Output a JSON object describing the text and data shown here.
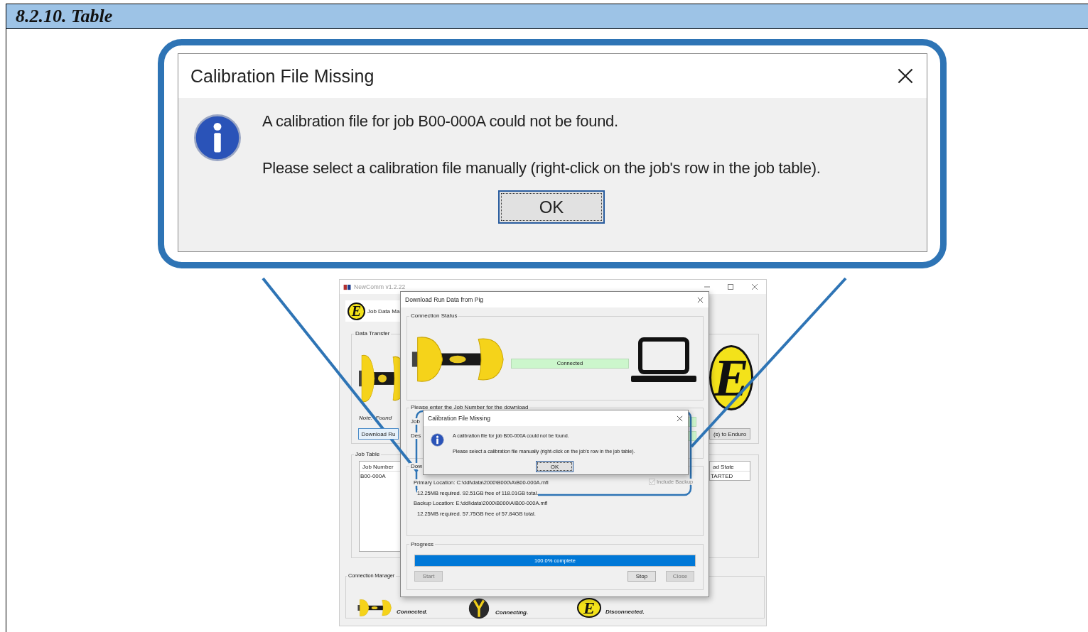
{
  "section_header": "8.2.10. Table",
  "callout": {
    "title": "Calibration File Missing",
    "message": "A calibration file for job B00-000A could not be found.",
    "instruction": "Please select a calibration file manually (right-click on the job's row in the job table).",
    "ok_button": "OK"
  },
  "app_window": {
    "title": "NewComm v1.2.22",
    "tab_logo": "E",
    "tab_label": "Job Data Ma",
    "data_transfer": {
      "label": "Data Transfer",
      "logo": "E",
      "note": "Note:  Found",
      "download_button": "Download Ru",
      "send_button": "(s) to Enduro"
    },
    "job_table": {
      "label": "Job Table",
      "columns": [
        "Job Number",
        "ad State"
      ],
      "rows": [
        [
          "B00-000A",
          "TARTED"
        ]
      ]
    },
    "connection_manager": {
      "label": "Connection Manager",
      "items": [
        {
          "kind": "pig",
          "label": "Connected."
        },
        {
          "kind": "probe",
          "label": "Connecting."
        },
        {
          "kind": "logo",
          "label": "Disconnected.",
          "logo": "E"
        }
      ]
    }
  },
  "download_dialog": {
    "title": "Download Run Data from Pig",
    "connection_status": {
      "label": "Connection Status",
      "status": "Connected"
    },
    "job_group": {
      "label": "Please enter the Job Number for the download",
      "job_label": "Job",
      "description_label": "Des"
    },
    "download_group": {
      "label": "Dow",
      "primary_location": "Primary Location:  C:\\ddl\\data\\2000\\B000\\A\\B00-000A.mfl",
      "primary_space": "12.25MB required. 92.51GB free of 118.01GB total.",
      "backup_location": "Backup Location:  E:\\ddl\\data\\2000\\B000\\A\\B00-000A.mfl",
      "backup_space": "12.25MB required. 57.75GB free of 57.84GB total.",
      "include_backup": {
        "label": "Include Backup",
        "checked": true,
        "disabled": true
      }
    },
    "progress": {
      "label": "Progress",
      "level": 1.0,
      "text": "100.0% complete"
    },
    "buttons": [
      {
        "label": "Start",
        "disabled": true
      },
      {
        "label": "Stop",
        "disabled": false
      },
      {
        "label": "Close",
        "disabled": true
      }
    ]
  },
  "small_dialog": {
    "title": "Calibration File Missing",
    "message": "A calibration file for job B00-000A could not be found.",
    "instruction": "Please select a calibration file manually (right-click on the job's row in the job table).",
    "ok_button": "OK"
  }
}
